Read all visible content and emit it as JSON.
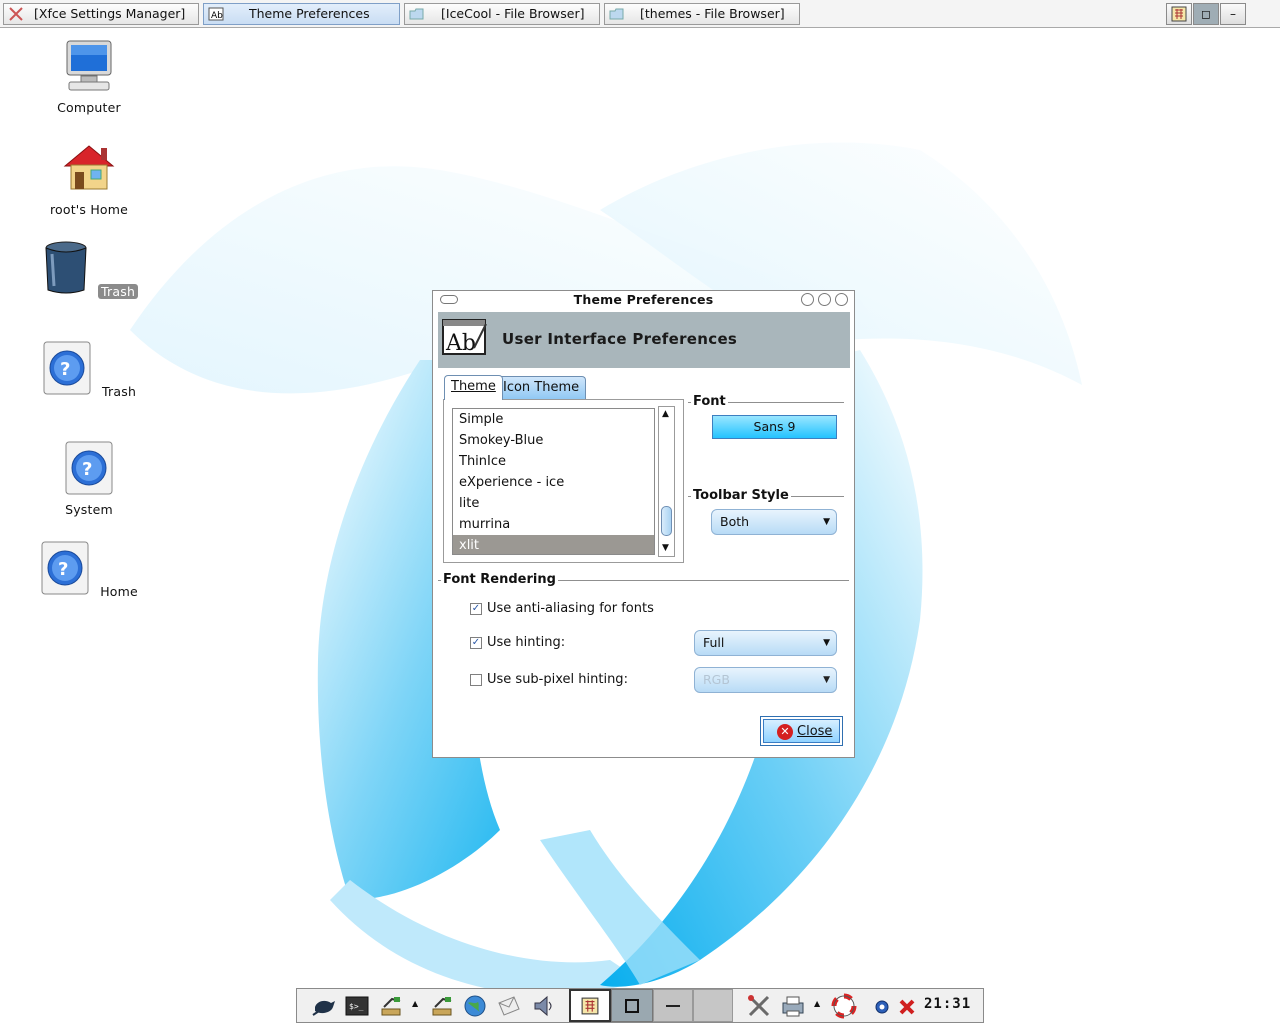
{
  "taskbar": {
    "tasks": [
      {
        "label": "[Xfce Settings Manager]",
        "icon": "xfce-settings-icon",
        "active": false
      },
      {
        "label": "Theme Preferences",
        "icon": "theme-prefs-icon",
        "active": true
      },
      {
        "label": "[IceCool - File Browser]",
        "icon": "folder-icon",
        "active": false
      },
      {
        "label": "[themes - File Browser]",
        "icon": "folder-icon",
        "active": false
      }
    ],
    "window_buttons": {
      "menu": "▦",
      "maximize": "◻",
      "minimize": "–"
    }
  },
  "desktop": {
    "icons": [
      {
        "label": "Computer",
        "icon": "computer-icon",
        "selected": false
      },
      {
        "label": "root's Home",
        "icon": "home-house-icon",
        "selected": false
      },
      {
        "label": "Trash",
        "icon": "trash-can-icon",
        "selected": true
      },
      {
        "label": "Trash",
        "icon": "help-icon",
        "selected": false
      },
      {
        "label": "System",
        "icon": "help-icon",
        "selected": false
      },
      {
        "label": "Home",
        "icon": "help-icon",
        "selected": false
      }
    ]
  },
  "dialog": {
    "title": "Theme Preferences",
    "banner_title": "User Interface Preferences",
    "tabs": [
      {
        "label": "Theme",
        "active": true
      },
      {
        "label": "Icon Theme",
        "active": false
      }
    ],
    "themes": [
      "Simple",
      "Smokey-Blue",
      "ThinIce",
      "eXperience - ice",
      "lite",
      "murrina",
      "xlit"
    ],
    "selected_theme": "xlit",
    "font_section": "Font",
    "font_value": "Sans 9",
    "toolbar_section": "Toolbar Style",
    "toolbar_style": "Both",
    "rendering_section": "Font Rendering",
    "antialias_label": "Use anti-aliasing for fonts",
    "antialias_checked": true,
    "hinting_label": "Use hinting:",
    "hinting_checked": true,
    "hinting_value": "Full",
    "subpixel_label": "Use sub-pixel hinting:",
    "subpixel_checked": false,
    "subpixel_value": "RGB",
    "close_label": "Close"
  },
  "bottom_panel": {
    "launchers": [
      "xfce-mouse-icon",
      "terminal-icon",
      "file-manager-icon",
      "file-manager-icon",
      "web-browser-icon",
      "mail-icon",
      "sound-icon"
    ],
    "workspaces": [
      "1",
      "2",
      "3",
      "4"
    ],
    "tools": [
      "settings-tools-icon",
      "printer-icon",
      "help-lifebuoy-icon",
      "info-icon",
      "logout-icon"
    ],
    "clock": "21:31"
  },
  "colors": {
    "banner_bg": "#a9b6bb",
    "font_button": "#23c3ff",
    "selection": "#9b9893",
    "wallpaper_blue": "#19b8f2"
  }
}
